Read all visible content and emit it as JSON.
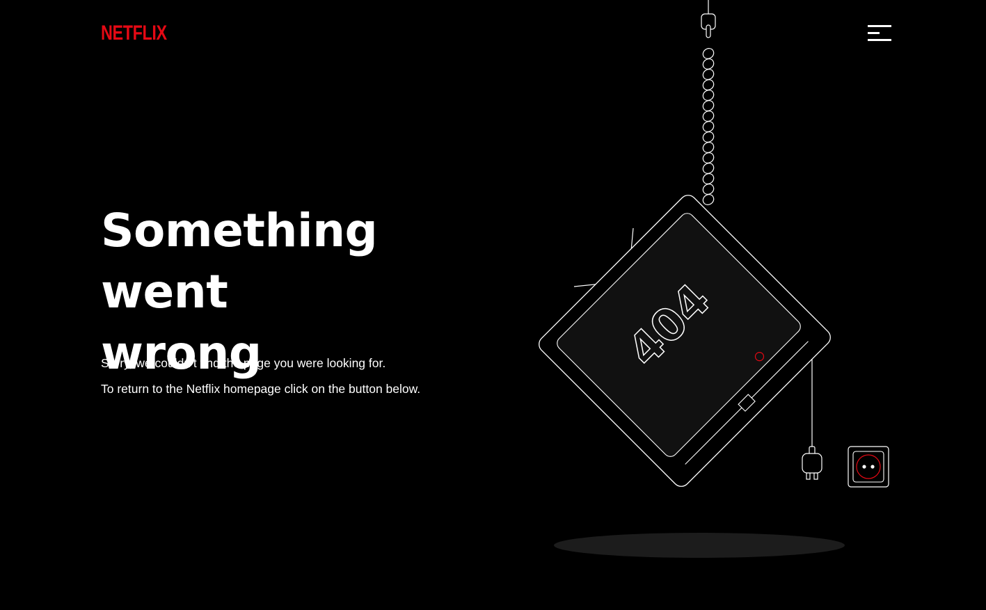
{
  "header": {
    "logo_text": "NETFLIX",
    "menu_icon": "hamburger-menu-icon"
  },
  "main": {
    "headline_line1": "Something went",
    "headline_line2": "wrong",
    "message_1": "Sorry, we couldn’t find the page you were looking for.",
    "message_2": "To return to the Netflix homepage click on the button below."
  },
  "illustration": {
    "screen_text": "404",
    "icons": [
      "hanging-tv-icon",
      "rope-icon",
      "power-plug-icon",
      "wall-outlet-icon"
    ]
  },
  "colors": {
    "background": "#000000",
    "brand_red": "#e50914",
    "text": "#ffffff",
    "tv_fill": "#111111"
  }
}
